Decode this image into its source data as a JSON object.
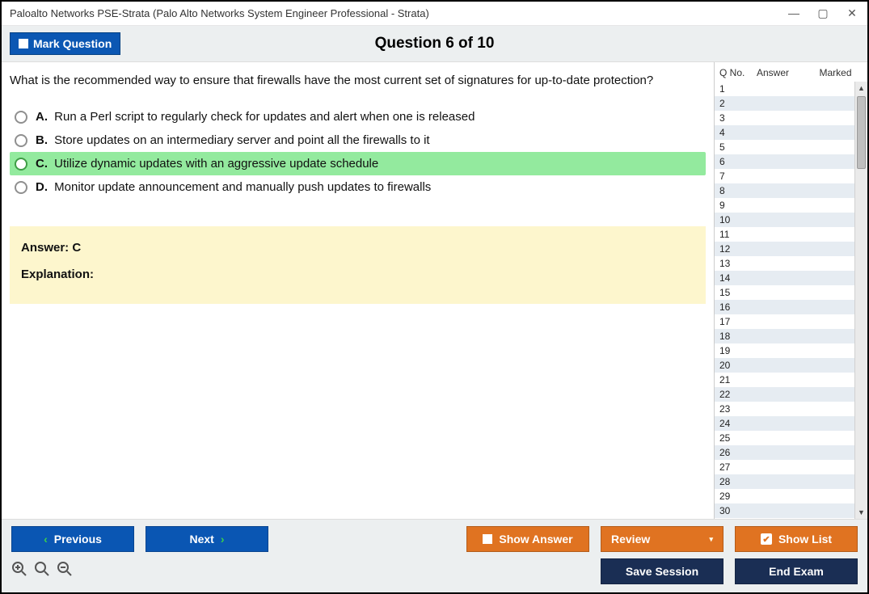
{
  "window": {
    "title": "Paloalto Networks PSE-Strata (Palo Alto Networks System Engineer Professional - Strata)"
  },
  "topbar": {
    "mark_label": "Mark Question",
    "question_header": "Question 6 of 10"
  },
  "question": {
    "text": "What is the recommended way to ensure that firewalls have the most current set of signatures for up-to-date protection?",
    "choices": [
      {
        "letter": "A.",
        "text": "Run a Perl script to regularly check for updates and alert when one is released",
        "highlight": false
      },
      {
        "letter": "B.",
        "text": "Store updates on an intermediary server and point all the firewalls to it",
        "highlight": false
      },
      {
        "letter": "C.",
        "text": "Utilize dynamic updates with an aggressive update schedule",
        "highlight": true
      },
      {
        "letter": "D.",
        "text": "Monitor update announcement and manually push updates to firewalls",
        "highlight": false
      }
    ]
  },
  "answer_box": {
    "answer_label": "Answer: C",
    "explanation_label": "Explanation:"
  },
  "sidebar": {
    "headers": {
      "qno": "Q No.",
      "answer": "Answer",
      "marked": "Marked"
    },
    "rows": [
      1,
      2,
      3,
      4,
      5,
      6,
      7,
      8,
      9,
      10,
      11,
      12,
      13,
      14,
      15,
      16,
      17,
      18,
      19,
      20,
      21,
      22,
      23,
      24,
      25,
      26,
      27,
      28,
      29,
      30
    ]
  },
  "buttons": {
    "previous": "Previous",
    "next": "Next",
    "show_answer": "Show Answer",
    "review": "Review",
    "show_list": "Show List",
    "save_session": "Save Session",
    "end_exam": "End Exam"
  }
}
